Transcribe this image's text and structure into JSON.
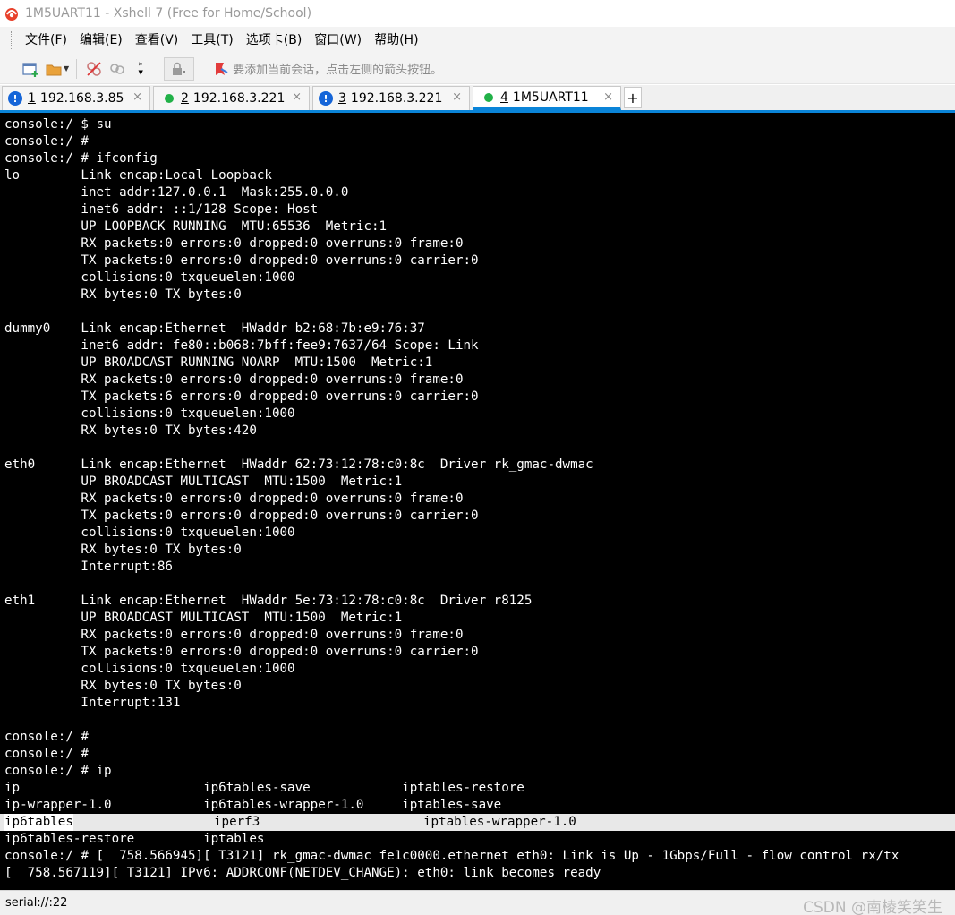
{
  "window": {
    "title": "1M5UART11 - Xshell 7 (Free for Home/School)",
    "icon": "xshell-icon"
  },
  "menu": {
    "items": [
      "文件(F)",
      "编辑(E)",
      "查看(V)",
      "工具(T)",
      "选项卡(B)",
      "窗口(W)",
      "帮助(H)"
    ]
  },
  "toolbar": {
    "hint": "要添加当前会话，点击左侧的箭头按钮。",
    "icons": [
      "new-session-icon",
      "open-folder-icon",
      "disconnect-icon",
      "reconnect-icon",
      "more-icon",
      "lock-icon",
      "bookmark-icon"
    ]
  },
  "tabs": [
    {
      "num": "1",
      "label": "192.168.3.85",
      "status": "warning",
      "active": false,
      "close": "×"
    },
    {
      "num": "2",
      "label": "192.168.3.221",
      "status": "connected",
      "active": false,
      "close": "×"
    },
    {
      "num": "3",
      "label": "192.168.3.221",
      "status": "warning",
      "active": false,
      "close": "×"
    },
    {
      "num": "4",
      "label": "1M5UART11",
      "status": "connected",
      "active": true,
      "close": "×"
    }
  ],
  "tab_add_label": "+",
  "terminal": {
    "lines": [
      "console:/ $ su",
      "console:/ #",
      "console:/ # ifconfig",
      "lo        Link encap:Local Loopback",
      "          inet addr:127.0.0.1  Mask:255.0.0.0",
      "          inet6 addr: ::1/128 Scope: Host",
      "          UP LOOPBACK RUNNING  MTU:65536  Metric:1",
      "          RX packets:0 errors:0 dropped:0 overruns:0 frame:0",
      "          TX packets:0 errors:0 dropped:0 overruns:0 carrier:0",
      "          collisions:0 txqueuelen:1000",
      "          RX bytes:0 TX bytes:0",
      "",
      "dummy0    Link encap:Ethernet  HWaddr b2:68:7b:e9:76:37",
      "          inet6 addr: fe80::b068:7bff:fee9:7637/64 Scope: Link",
      "          UP BROADCAST RUNNING NOARP  MTU:1500  Metric:1",
      "          RX packets:0 errors:0 dropped:0 overruns:0 frame:0",
      "          TX packets:6 errors:0 dropped:0 overruns:0 carrier:0",
      "          collisions:0 txqueuelen:1000",
      "          RX bytes:0 TX bytes:420",
      "",
      "eth0      Link encap:Ethernet  HWaddr 62:73:12:78:c0:8c  Driver rk_gmac-dwmac",
      "          UP BROADCAST MULTICAST  MTU:1500  Metric:1",
      "          RX packets:0 errors:0 dropped:0 overruns:0 frame:0",
      "          TX packets:0 errors:0 dropped:0 overruns:0 carrier:0",
      "          collisions:0 txqueuelen:1000",
      "          RX bytes:0 TX bytes:0",
      "          Interrupt:86",
      "",
      "eth1      Link encap:Ethernet  HWaddr 5e:73:12:78:c0:8c  Driver r8125",
      "          UP BROADCAST MULTICAST  MTU:1500  Metric:1",
      "          RX packets:0 errors:0 dropped:0 overruns:0 frame:0",
      "          TX packets:0 errors:0 dropped:0 overruns:0 carrier:0",
      "          collisions:0 txqueuelen:1000",
      "          RX bytes:0 TX bytes:0",
      "          Interrupt:131",
      "",
      "console:/ #",
      "console:/ #",
      "console:/ # ip",
      "ip                        ip6tables-save            iptables-restore",
      "ip-wrapper-1.0            ip6tables-wrapper-1.0     iptables-save",
      "",
      "ip6tables-restore         iptables",
      "console:/ # [  758.566945][ T3121] rk_gmac-dwmac fe1c0000.ethernet eth0: Link is Up - 1Gbps/Full - flow control rx/tx",
      "[  758.567119][ T3121] IPv6: ADDRCONF(NETDEV_CHANGE): eth0: link becomes ready"
    ],
    "highlight": {
      "col1": "ip6tables",
      "col2": "iperf3",
      "col3": "iptables-wrapper-1.0"
    }
  },
  "status": {
    "session": "serial://:22",
    "watermark": "CSDN @南棱笑笑生"
  }
}
